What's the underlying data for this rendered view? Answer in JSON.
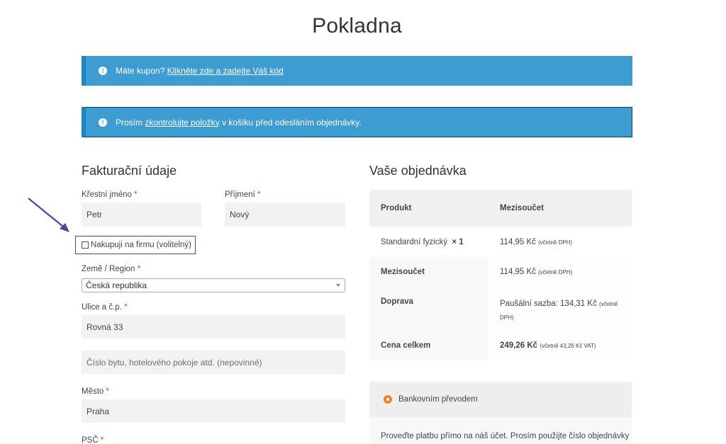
{
  "page": {
    "title": "Pokladna"
  },
  "notices": {
    "coupon": {
      "text": "Máte kupon?",
      "link": "Klikněte zde a zadejte Váš kód"
    },
    "check": {
      "before": "Prosím",
      "link": "zkontrolujte položky",
      "after": "v košíku před odesláním objednávky."
    }
  },
  "billing": {
    "heading": "Fakturační údaje",
    "first_name": {
      "label": "Křestní jméno",
      "value": "Petr"
    },
    "last_name": {
      "label": "Příjmení",
      "value": "Nový"
    },
    "company_checkbox": {
      "label": "Nakupuji na firmu (volitelný)"
    },
    "country": {
      "label": "Země / Region",
      "value": "Česká republika"
    },
    "street": {
      "label": "Ulice a č.p.",
      "value": "Rovná 33"
    },
    "apartment": {
      "placeholder": "Číslo bytu, hotelového pokoje atd. (nepovinné)"
    },
    "city": {
      "label": "Město",
      "value": "Praha"
    },
    "zip": {
      "label": "PSČ"
    },
    "required_mark": "*"
  },
  "order": {
    "heading": "Vaše objednávka",
    "header": {
      "product": "Produkt",
      "subtotal": "Mezisoučet"
    },
    "item": {
      "name": "Standardní fyzický",
      "qty": "× 1",
      "price": "114,95 Kč",
      "tax_note": "(včetně DPH)"
    },
    "subtotal": {
      "label": "Mezisoučet",
      "price": "114,95 Kč",
      "tax_note": "(včetně DPH)"
    },
    "shipping": {
      "label": "Doprava",
      "line1": "Paušální sazba: 134,31 Kč",
      "line1_note": "(včetně",
      "line2_note": "DPH)"
    },
    "total": {
      "label": "Cena celkem",
      "price": "249,26 Kč",
      "tax_note": "(včetně 43,26 Kč VAT)"
    }
  },
  "payment": {
    "method": "Bankovním převodem",
    "description": "Proveďte platbu přímo na náš účet. Prosím použijte číslo objednávky"
  },
  "colors": {
    "notice_bg": "#3d9cd2",
    "required": "#e2401c",
    "radio": "#f5821f",
    "highlight_border": "#5a3f9b"
  }
}
